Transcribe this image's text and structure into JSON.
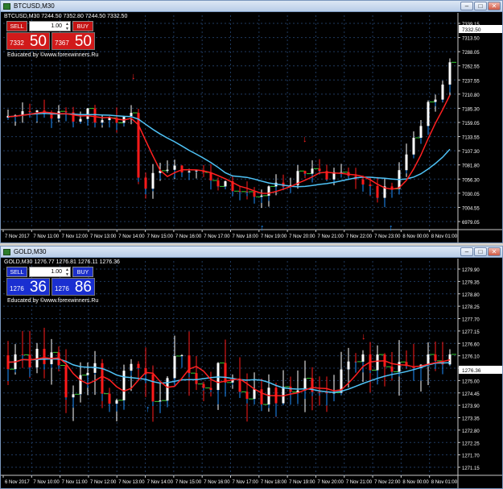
{
  "window1": {
    "title": "BTCUSD,M30",
    "symbol_line": "BTCUSD,M30 7244.50 7352.80 7244.50 7332.50",
    "sell_label": "SELL",
    "buy_label": "BUY",
    "lot": "1.00",
    "sell_small": "7332",
    "sell_big": "50",
    "buy_small": "7367",
    "buy_big": "50",
    "educated": "Educated by ©www.forexwinners.Ru",
    "panel_color": "#d11a1a",
    "price_labels": [
      "7339.15",
      "7313.50",
      "7288.05",
      "7262.55",
      "7237.55",
      "7210.80",
      "7185.30",
      "7159.05",
      "7133.55",
      "7107.30",
      "7081.80",
      "7056.30",
      "7030.05",
      "7004.55",
      "6979.05"
    ],
    "current_price": "7332.50",
    "time_labels": [
      "7 Nov 2017",
      "7 Nov 11:00",
      "7 Nov 12:00",
      "7 Nov 13:00",
      "7 Nov 14:00",
      "7 Nov 15:00",
      "7 Nov 16:00",
      "7 Nov 17:00",
      "7 Nov 18:00",
      "7 Nov 19:00",
      "7 Nov 20:00",
      "7 Nov 21:00",
      "7 Nov 22:00",
      "7 Nov 23:00",
      "8 Nov 00:00",
      "8 Nov 01:00"
    ]
  },
  "window2": {
    "title": "GOLD,M30",
    "symbol_line": "GOLD,M30 1276.77 1276.81 1276.11 1276.36",
    "sell_label": "SELL",
    "buy_label": "BUY",
    "lot": "1.00",
    "sell_small": "1276",
    "sell_big": "36",
    "buy_small": "1276",
    "buy_big": "86",
    "educated": "Educated by ©www.forexwinners.Ru",
    "panel_color": "#1a2fd1",
    "price_labels": [
      "1279.90",
      "1279.35",
      "1278.80",
      "1278.25",
      "1277.70",
      "1277.15",
      "1276.60",
      "1276.10",
      "1275.55",
      "1275.00",
      "1274.45",
      "1273.90",
      "1273.35",
      "1272.80",
      "1272.25",
      "1271.70",
      "1271.15"
    ],
    "current_price": "1276.36",
    "time_labels": [
      "6 Nov 2017",
      "7 Nov 10:00",
      "7 Nov 11:00",
      "7 Nov 12:00",
      "7 Nov 13:00",
      "7 Nov 14:00",
      "7 Nov 15:00",
      "7 Nov 16:00",
      "7 Nov 17:00",
      "7 Nov 18:00",
      "7 Nov 19:00",
      "7 Nov 20:00",
      "7 Nov 21:00",
      "7 Nov 22:00",
      "8 Nov 00:00",
      "8 Nov 01:00"
    ]
  },
  "colors": {
    "up": "#ffffff",
    "down": "#ff1a1a",
    "ma_fast": "#1e90ff",
    "ma_slow": "#4fc3f7",
    "signal_up": "#1e90ff",
    "signal_down": "#ff2020",
    "grid": "#1f3a5f",
    "level": "#33cc33"
  }
}
